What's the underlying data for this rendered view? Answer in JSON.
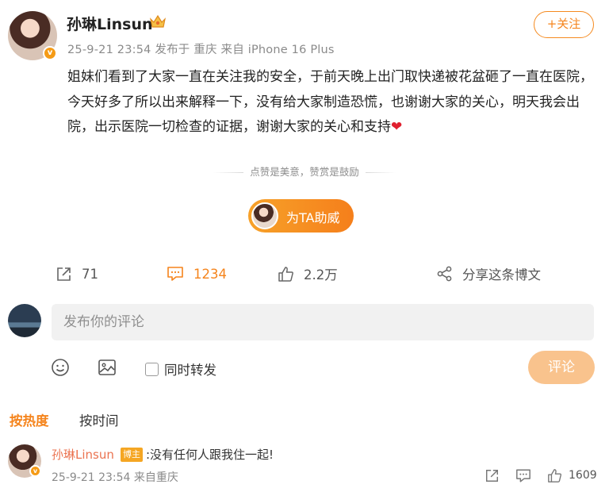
{
  "post": {
    "author": "孙琳Linsun",
    "meta": "25-9-21 23:54  发布于 重庆  来自 iPhone 16 Plus",
    "follow_label": "+关注",
    "text": "姐妹们看到了大家一直在关注我的安全，于前天晚上出门取快递被花盆砸了一直在医院，今天好多了所以出来解释一下，没有给大家制造恐慌，也谢谢大家的关心，明天我会出院，出示医院一切检查的证据，谢谢大家的关心和支持",
    "heart": "❤"
  },
  "reward": {
    "tip": "点赞是美意，赞赏是鼓励",
    "button_label": "为TA助威"
  },
  "actions": {
    "repost_count": "71",
    "comment_count": "1234",
    "like_count": "2.2万",
    "share_label": "分享这条博文"
  },
  "composer": {
    "placeholder": "发布你的评论",
    "repost_label": "同时转发",
    "submit_label": "评论"
  },
  "sort": {
    "hot_label": "按热度",
    "time_label": "按时间"
  },
  "comment": {
    "author": "孙琳Linsun",
    "badge": "博主",
    "text": ":没有任何人跟我住一起!",
    "meta": "25-9-21 23:54 来自重庆",
    "like_count": "1609"
  },
  "colors": {
    "accent": "#f5841c",
    "name_link": "#eb7350",
    "submit_disabled": "#f9c38d"
  }
}
